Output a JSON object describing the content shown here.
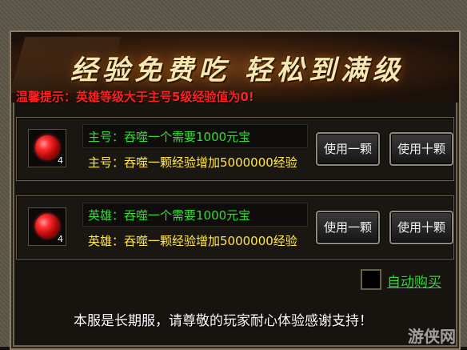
{
  "banner": {
    "title": "经验免费吃  轻松到满级",
    "tip": "温馨提示：英雄等级大于主号5级经验值为0!"
  },
  "panels": [
    {
      "item_count": "4",
      "line1": "主号：吞噬一个需要1000元宝",
      "line2": "主号：吞噬一颗经验增加5000000经验",
      "use_one": "使用一颗",
      "use_ten": "使用十颗"
    },
    {
      "item_count": "4",
      "line1": "英雄：吞噬一个需要1000元宝",
      "line2": "英雄：吞噬一颗经验增加5000000经验",
      "use_one": "使用一颗",
      "use_ten": "使用十颗"
    }
  ],
  "auto_buy": {
    "label": "自动购买",
    "checked": false
  },
  "footer": "本服是长期服，请尊敬的玩家耐心体验感谢支持！",
  "watermark": "游侠网",
  "colors": {
    "green_text": "#33dd33",
    "yellow_text": "#ffe74a",
    "tip_red": "#ff2020",
    "title_gold": "#f7e7b0"
  }
}
